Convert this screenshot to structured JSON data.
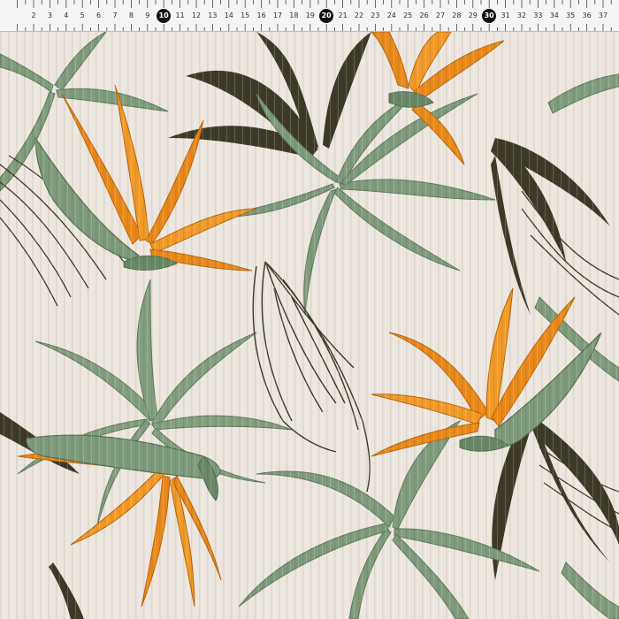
{
  "ruler": {
    "labels": [
      "2",
      "3",
      "4",
      "5",
      "6",
      "7",
      "8",
      "9",
      "10",
      "11",
      "12",
      "13",
      "14",
      "15",
      "16",
      "17",
      "18",
      "19",
      "20",
      "21",
      "22",
      "23",
      "24",
      "25",
      "26",
      "27",
      "28",
      "29",
      "30",
      "31",
      "32",
      "33",
      "34",
      "35",
      "36",
      "37"
    ],
    "highlighted": [
      "10",
      "20",
      "30"
    ]
  },
  "colors": {
    "background": "#ece6df",
    "orange": "#e8891c",
    "sage": "#7e9a7c",
    "dark_olive": "#3a3526",
    "ruler_bg": "#f4f4f4"
  }
}
